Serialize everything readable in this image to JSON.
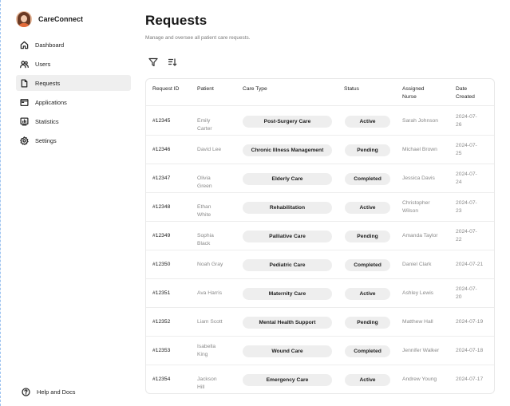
{
  "app": {
    "name": "CareConnect"
  },
  "sidebar": {
    "items": [
      {
        "label": "Dashboard",
        "icon": "home-icon",
        "active": false
      },
      {
        "label": "Users",
        "icon": "users-icon",
        "active": false
      },
      {
        "label": "Requests",
        "icon": "file-icon",
        "active": true
      },
      {
        "label": "Applications",
        "icon": "window-icon",
        "active": false
      },
      {
        "label": "Statistics",
        "icon": "chart-icon",
        "active": false
      },
      {
        "label": "Settings",
        "icon": "gear-icon",
        "active": false
      }
    ],
    "help_label": "Help and Docs"
  },
  "page": {
    "title": "Requests",
    "subtitle": "Manage and oversee all patient care requests."
  },
  "toolbar": {
    "filter_icon": "filter-icon",
    "sort_icon": "sort-icon"
  },
  "table": {
    "columns": [
      "Request ID",
      "Patient",
      "Care Type",
      "Status",
      "Assigned Nurse",
      "Date Created"
    ],
    "rows": [
      {
        "id": "#12345",
        "patient": "Emily Carter",
        "care": "Post-Surgery Care",
        "status": "Active",
        "nurse": "Sarah Johnson",
        "date": "2024-07-26"
      },
      {
        "id": "#12346",
        "patient": "David Lee",
        "care": "Chronic Illness Management",
        "status": "Pending",
        "nurse": "Michael Brown",
        "date": "2024-07-25"
      },
      {
        "id": "#12347",
        "patient": "Olivia Green",
        "care": "Elderly Care",
        "status": "Completed",
        "nurse": "Jessica Davis",
        "date": "2024-07-24"
      },
      {
        "id": "#12348",
        "patient": "Ethan White",
        "care": "Rehabilitation",
        "status": "Active",
        "nurse": "Christopher Wilson",
        "date": "2024-07-23"
      },
      {
        "id": "#12349",
        "patient": "Sophia Black",
        "care": "Palliative Care",
        "status": "Pending",
        "nurse": "Amanda Taylor",
        "date": "2024-07-22"
      },
      {
        "id": "#12350",
        "patient": "Noah Gray",
        "care": "Pediatric Care",
        "status": "Completed",
        "nurse": "Daniel Clark",
        "date": "2024-07-21"
      },
      {
        "id": "#12351",
        "patient": "Ava Harris",
        "care": "Maternity Care",
        "status": "Active",
        "nurse": "Ashley Lewis",
        "date": "2024-07-20"
      },
      {
        "id": "#12352",
        "patient": "Liam Scott",
        "care": "Mental Health Support",
        "status": "Pending",
        "nurse": "Matthew Hall",
        "date": "2024-07-19"
      },
      {
        "id": "#12353",
        "patient": "Isabella King",
        "care": "Wound Care",
        "status": "Completed",
        "nurse": "Jennifer Walker",
        "date": "2024-07-18"
      },
      {
        "id": "#12354",
        "patient": "Jackson Hill",
        "care": "Emergency Care",
        "status": "Active",
        "nurse": "Andrew Young",
        "date": "2024-07-17"
      }
    ]
  }
}
